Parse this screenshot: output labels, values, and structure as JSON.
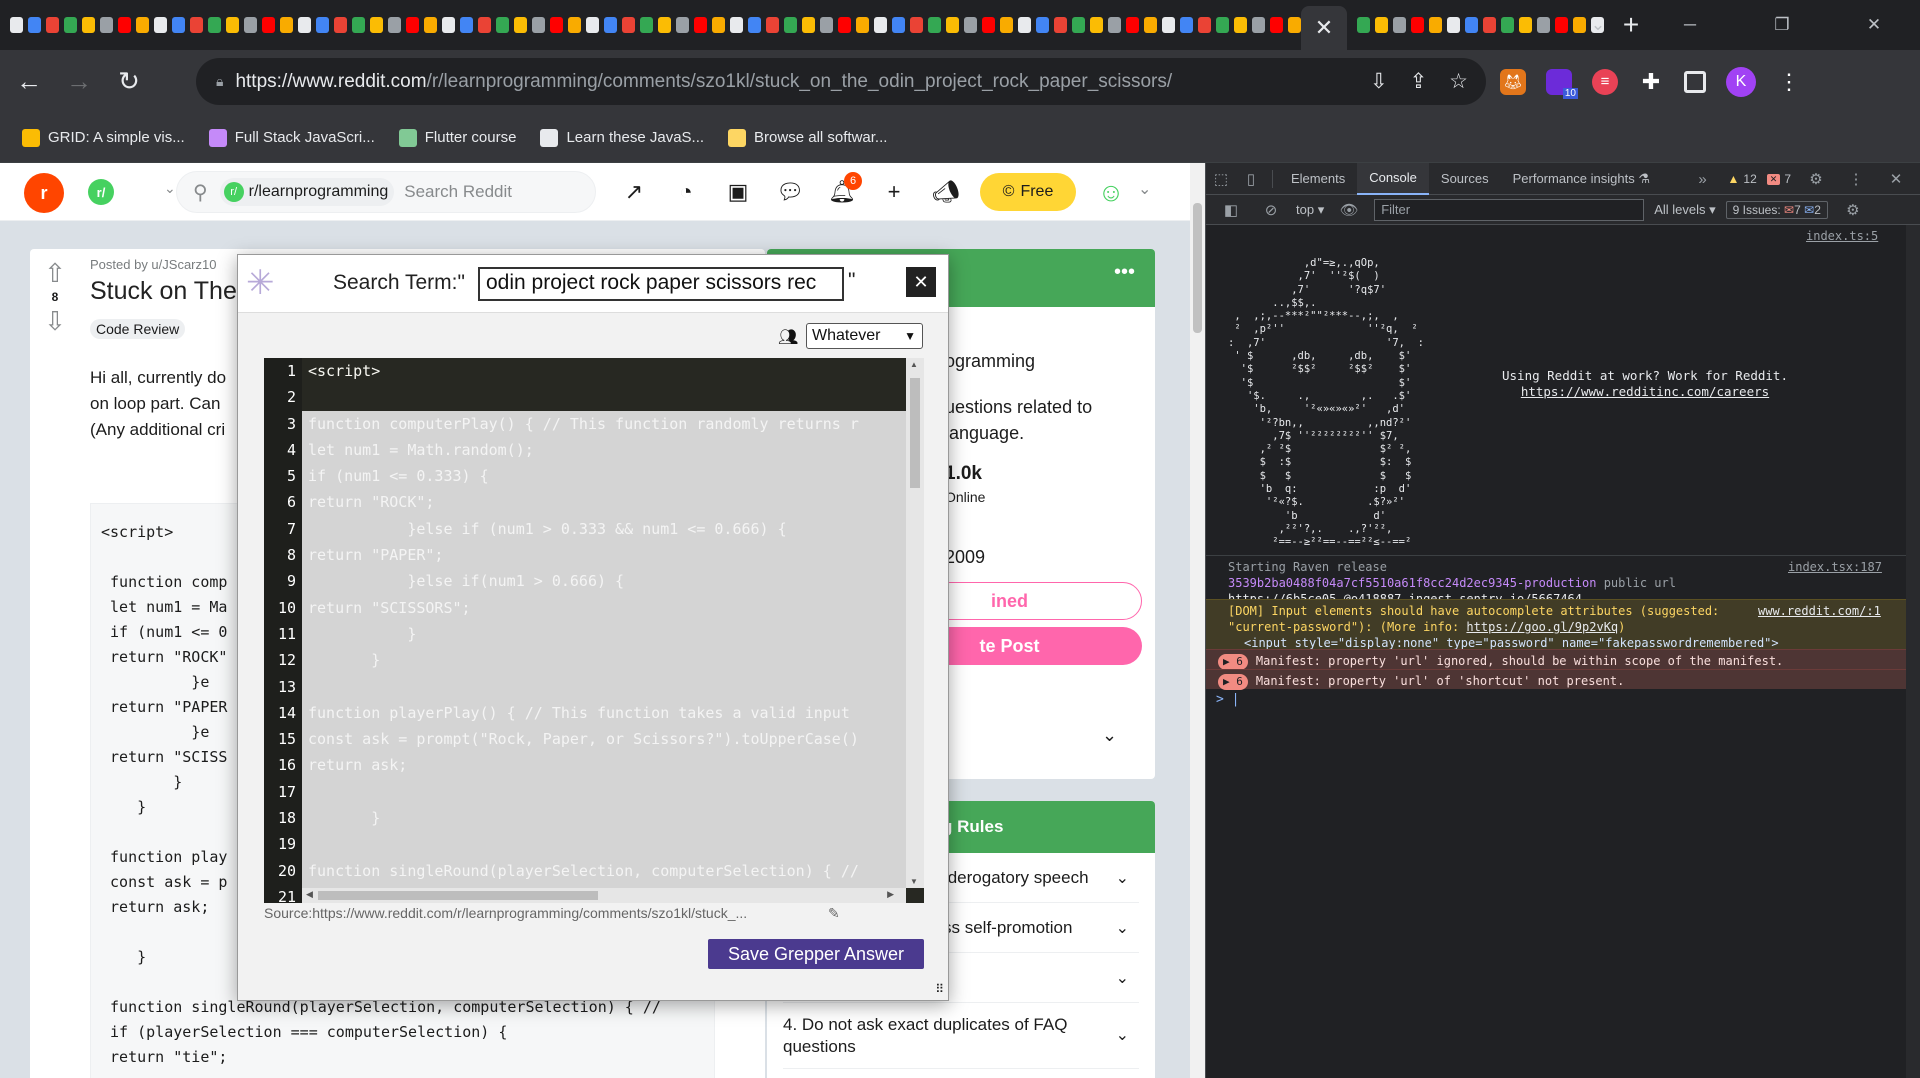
{
  "browser": {
    "tab_close": "✕",
    "new_tab": "+",
    "url_host": "https://www.reddit.com",
    "url_path": "/r/learnprogramming/comments/szo1kl/stuck_on_the_odin_project_rock_paper_scissors/",
    "profile_initial": "K",
    "ext_badge": "10",
    "bookmarks": [
      {
        "label": "GRID: A simple vis...",
        "color": "#fbbc04"
      },
      {
        "label": "Full Stack JavaScri...",
        "color": "#c58af9"
      },
      {
        "label": "Flutter course",
        "color": "#81c995"
      },
      {
        "label": "Learn these JavaS...",
        "color": "#e8eaed"
      },
      {
        "label": "Browse all softwar...",
        "color": "#fdd663"
      }
    ]
  },
  "reddit": {
    "logo": "r",
    "sub_icon": "r/",
    "search_chip": "r/learnprogramming",
    "search_placeholder": "Search Reddit",
    "notif_count": "6",
    "free_label": "Free",
    "post": {
      "vote_count": "8",
      "meta": "Posted by u/JScarz10",
      "title": "Stuck on The",
      "flair": "Code Review",
      "body_lines": [
        "Hi all, currently do",
        "on loop part. Can",
        "(Any additional cri"
      ],
      "code": "<script>\n\n function comp\n let num1 = Ma\n if (num1 <= 0\n return \"ROCK\"\n          }e\n return \"PAPER\n          }e\n return \"SCISS\n        }\n    }\n\n function play\n const ask = p\n return ask;\n\n    }\n\n function singleRound(playerSelection, computerSelection) { //\n if (playerSelection === computerSelection) {\n return \"tie\";"
    },
    "sidebar": {
      "about_title": "ogramming",
      "about_desc_1": "uestions related to",
      "about_desc_2": "language.",
      "members": "1.0k",
      "online": "Online",
      "created": "2009",
      "joined_label": "ined",
      "create_post": "te Post",
      "rules_title": "g Rules",
      "rules": [
        "/derogatory speech",
        "ss self-promotion",
        "",
        "4. Do not ask exact duplicates of FAQ questions"
      ]
    }
  },
  "grepper": {
    "label": "Search Term:\"",
    "search_value": "odin project rock paper scissors rec",
    "close_quote": "\"",
    "close": "✕",
    "team_option": "Whatever",
    "line_numbers": [
      "1",
      "2",
      "3",
      "4",
      "5",
      "6",
      "7",
      "8",
      "9",
      "10",
      "11",
      "12",
      "13",
      "14",
      "15",
      "16",
      "17",
      "18",
      "19",
      "20",
      "21"
    ],
    "code_lines": [
      "<script>",
      "",
      "function computerPlay() { // This function randomly returns r",
      "let num1 = Math.random();",
      "if (num1 <= 0.333) {",
      "return \"ROCK\";",
      "           }else if (num1 > 0.333 && num1 <= 0.666) {",
      "return \"PAPER\";",
      "           }else if(num1 > 0.666) {",
      "return \"SCISSORS\";",
      "           }",
      "       }",
      "",
      "function playerPlay() { // This function takes a valid input",
      "const ask = prompt(\"Rock, Paper, or Scissors?\").toUpperCase()",
      "return ask;",
      "",
      "       }",
      "",
      "function singleRound(playerSelection, computerSelection) { //",
      ""
    ],
    "source": "Source:https://www.reddit.com/r/learnprogramming/comments/szo1kl/stuck_...",
    "save_label": "Save Grepper Answer"
  },
  "devtools": {
    "tabs": [
      "Elements",
      "Console",
      "Sources",
      "Performance insights"
    ],
    "warn_count": "12",
    "error_count": "7",
    "context": "top",
    "filter_placeholder": "Filter",
    "levels": "All levels",
    "issues_label": "9 Issues:",
    "issues_errors": "7",
    "issues_info": "2",
    "ref1": "index.ts:5",
    "ascii_art": "            ,d\"=≥,.,qOp,\n           ,7'  ''²$(  )\n          ,7'      '?q$7'\n       ..,$$,.\n ,  ,;,--***²\"\"²***--,;,  ,\n ²  ,p²''             ''²q,  ²\n:  ,7'                   '7,  :\n ' $      ,db,     ,db,    $'\n  '$      ²$$²     ²$$²    $'\n  '$                       $'\n   '$.     .,        ,.   .$'\n    'b,     '²«»«»«»²'   ,d'\n     '²?bn,,          ,,nd?²'\n       ,7$ ''²²²²²²²²'' $7,\n     ,² ²$              $² ²,\n     $  :$              $:  $\n     $   $              $   $\n     'b  q:            :p  d'\n      '²«?$.          .$?»²'\n         'b            d'\n        ,²²'?,.    .,?'²²,\n       ²==--≥²²==--==²²≤--==²",
    "careers_1": "Using Reddit at work? Work for Reddit.",
    "careers_2": "https://www.redditinc.com/careers",
    "raven_1": "Starting Raven release",
    "raven_2": "3539b2ba0488f04a7cf5510a61f8cc24d2ec9345-production",
    "raven_3": "public url",
    "raven_4": "https://6b5ce05…@o418887.ingest.sentry.io/5667464",
    "ref2": "index.tsx:187",
    "warn_1": "[DOM] Input elements should have autocomplete attributes (suggested:",
    "warn_2": "\"current-password\"): (More info:",
    "warn_link": "https://goo.gl/9p2vKq",
    "warn_3": ")",
    "warn_4": "<input style=\"display:none\" type=\"password\" name=\"fakepasswordremembered\">",
    "ref3": "www.reddit.com/:1",
    "err_count": "6",
    "err_1": "Manifest: property 'url' ignored, should be within scope of the manifest.",
    "err_2": "Manifest: property 'url' of 'shortcut' not present.",
    "prompt": ">"
  }
}
